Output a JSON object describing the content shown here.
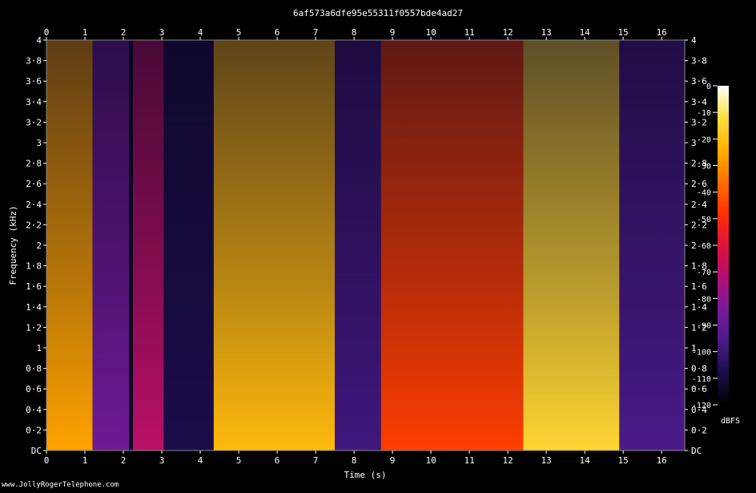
{
  "chart_data": {
    "type": "heatmap",
    "title": "6af573a6dfe95e55311f0557bde4ad27",
    "xlabel": "Time (s)",
    "ylabel": "Frequency (kHz)",
    "xlim": [
      0,
      16.6
    ],
    "ylim": [
      0,
      4
    ],
    "x_ticks": [
      "0",
      "1",
      "2",
      "3",
      "4",
      "5",
      "6",
      "7",
      "8",
      "9",
      "10",
      "11",
      "12",
      "13",
      "14",
      "15",
      "16"
    ],
    "y_ticks": [
      "DC",
      "0·2",
      "0·4",
      "0·6",
      "0·8",
      "1",
      "1·2",
      "1·4",
      "1·6",
      "1·8",
      "2",
      "2·2",
      "2·4",
      "2·6",
      "2·8",
      "3",
      "3·2",
      "3·4",
      "3·6",
      "3·8",
      "4"
    ],
    "colorbar": {
      "label": "dBFS",
      "ticks": [
        "0",
        "-10",
        "-20",
        "-30",
        "-40",
        "-50",
        "-60",
        "-70",
        "-80",
        "-90",
        "-100",
        "-110",
        "-120"
      ],
      "range": [
        -120,
        0
      ],
      "colors": [
        "#000000",
        "#1c0c4a",
        "#4a1a8a",
        "#7a1a9a",
        "#b01070",
        "#e01040",
        "#ff3000",
        "#ff7000",
        "#ffb000",
        "#ffe040",
        "#ffffff"
      ]
    },
    "segments": [
      {
        "start": 0.0,
        "end": 1.2,
        "level": 0.78
      },
      {
        "start": 1.2,
        "end": 2.15,
        "level": 0.28
      },
      {
        "start": 2.15,
        "end": 2.25,
        "level": 0.05
      },
      {
        "start": 2.25,
        "end": 3.05,
        "level": 0.42
      },
      {
        "start": 3.05,
        "end": 4.35,
        "level": 0.1
      },
      {
        "start": 4.35,
        "end": 7.5,
        "level": 0.82
      },
      {
        "start": 7.5,
        "end": 8.7,
        "level": 0.18
      },
      {
        "start": 8.7,
        "end": 12.4,
        "level": 0.62
      },
      {
        "start": 12.4,
        "end": 14.9,
        "level": 0.88
      },
      {
        "start": 14.9,
        "end": 16.6,
        "level": 0.2
      }
    ]
  },
  "footer": {
    "credit": "www.JollyRogerTelephone.com"
  }
}
